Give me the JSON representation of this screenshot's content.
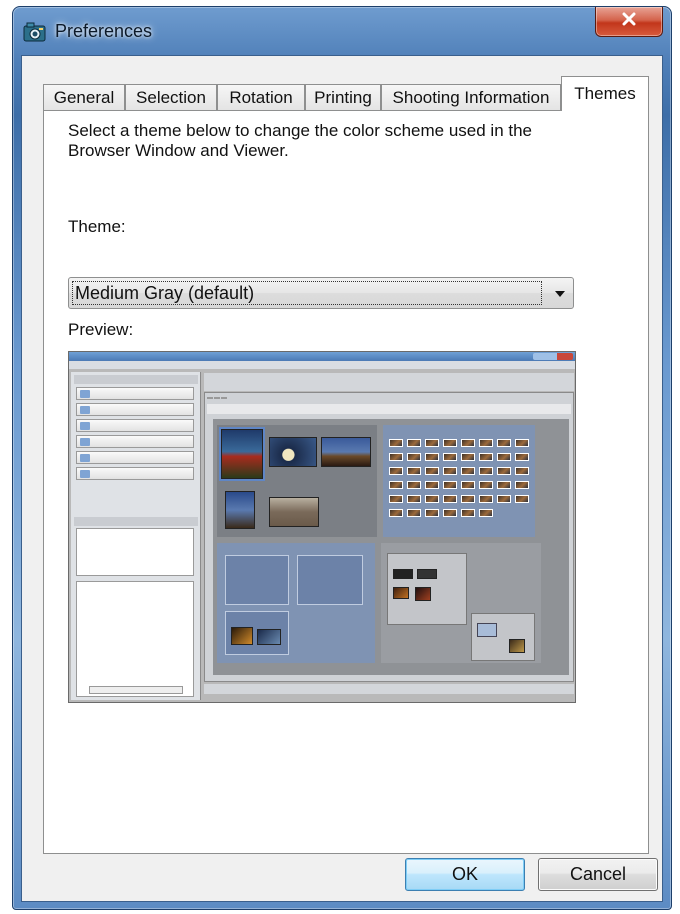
{
  "window": {
    "title": "Preferences"
  },
  "tabs": [
    {
      "label": "General"
    },
    {
      "label": "Selection"
    },
    {
      "label": "Rotation"
    },
    {
      "label": "Printing"
    },
    {
      "label": "Shooting Information"
    },
    {
      "label": "Themes",
      "active": true
    }
  ],
  "themes": {
    "description": "Select a theme below to change the color scheme used in the Browser Window and Viewer.",
    "theme_label": "Theme:",
    "theme_selected": "Medium Gray (default)",
    "preview_label": "Preview:"
  },
  "buttons": {
    "ok": "OK",
    "cancel": "Cancel"
  },
  "colors": {
    "window_frame": "#4f7fb8",
    "client_bg": "#f0f0f0",
    "close_button": "#c2361b",
    "ok_button": "#bee6fd"
  },
  "icons": {
    "app": "camera-icon",
    "close": "close-icon",
    "dropdown": "chevron-down-icon"
  }
}
